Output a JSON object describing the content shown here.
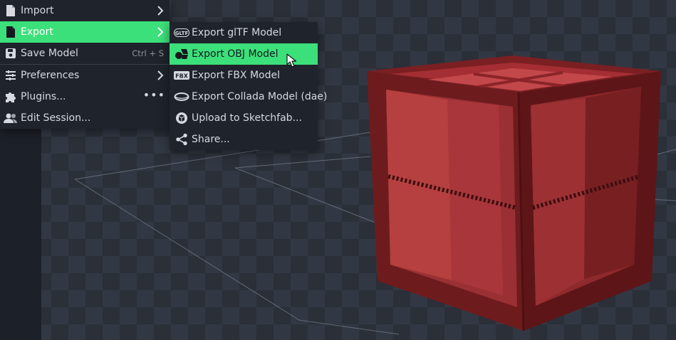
{
  "main_menu": {
    "items": [
      {
        "label": "Import",
        "icon": "file-icon"
      },
      {
        "label": "Export",
        "icon": "file-icon"
      },
      {
        "label": "Save Model",
        "shortcut": "Ctrl + S",
        "icon": "save-icon"
      },
      {
        "label": "Preferences",
        "icon": "sliders-icon"
      },
      {
        "label": "Plugins...",
        "icon": "puzzle-icon",
        "more": "•••"
      },
      {
        "label": "Edit Session...",
        "icon": "users-icon"
      }
    ]
  },
  "export_submenu": {
    "items": [
      {
        "label": "Export glTF Model",
        "icon": "gltf-icon",
        "icon_text": "GLTF"
      },
      {
        "label": "Export OBJ Model",
        "icon": "obj-icon"
      },
      {
        "label": "Export FBX Model",
        "icon": "fbx-icon",
        "icon_text": "FBX"
      },
      {
        "label": "Export Collada Model (dae)",
        "icon": "collada-icon"
      },
      {
        "label": "Upload to Sketchfab...",
        "icon": "sketchfab-icon"
      },
      {
        "label": "Share...",
        "icon": "share-icon"
      }
    ]
  },
  "colors": {
    "highlight": "#3ce07a",
    "menu_bg": "#1f232b",
    "crate_dark": "#6a1a1c",
    "crate_light": "#b83a3e"
  }
}
